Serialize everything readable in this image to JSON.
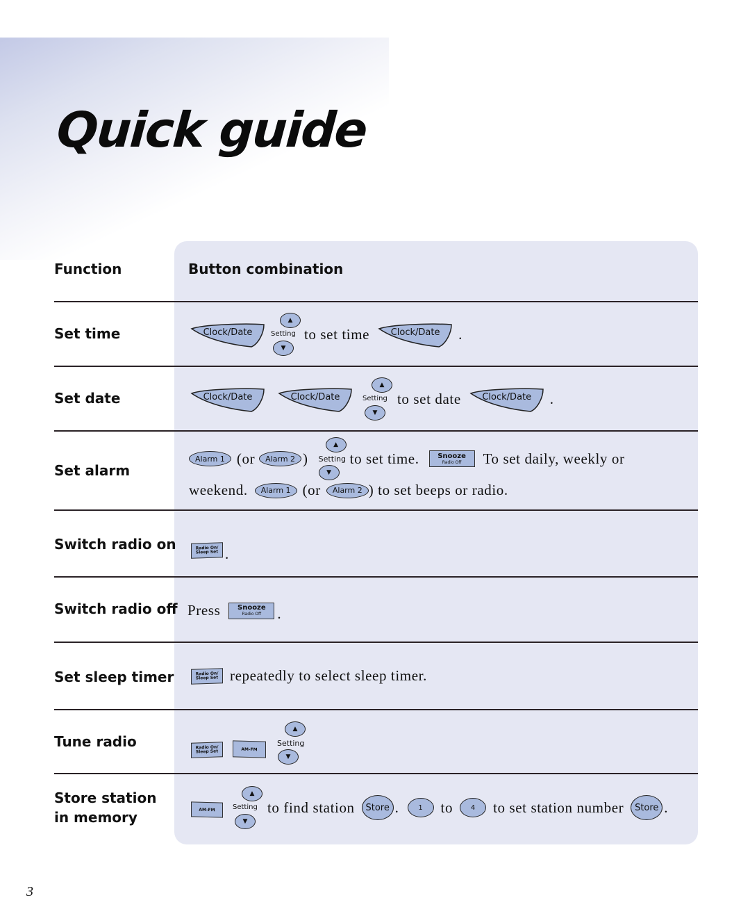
{
  "page": {
    "title": "Quick guide",
    "page_number": "3",
    "colors": {
      "panel": "#e5e7f3",
      "button": "#a9bade",
      "rule": "#2a2226"
    }
  },
  "table": {
    "headers": {
      "function": "Function",
      "combination": "Button combination"
    },
    "rows": [
      {
        "function": "Set time",
        "steps": {
          "b1": "Clock/Date",
          "setting": "Setting",
          "up": "▲",
          "down": "▼",
          "t1": "to set time",
          "b2": "Clock/Date",
          "end": "."
        }
      },
      {
        "function": "Set date",
        "steps": {
          "b1": "Clock/Date",
          "b2": "Clock/Date",
          "setting": "Setting",
          "up": "▲",
          "down": "▼",
          "t1": "to set date",
          "b3": "Clock/Date",
          "end": "."
        }
      },
      {
        "function": "Set alarm",
        "steps": {
          "alarm1": "Alarm 1",
          "or1": "(or",
          "alarm2": "Alarm 2",
          "close1": ")",
          "setting": "Setting",
          "up": "▲",
          "down": "▼",
          "t1": "to set time.",
          "snooze": "Snooze",
          "snooze_sub": "Radio Off",
          "t2": "To set daily, weekly or",
          "t3": "weekend.",
          "alarm1b": "Alarm 1",
          "or2": "(or",
          "alarm2b": "Alarm 2",
          "t4": ") to set beeps or radio."
        }
      },
      {
        "function": "Switch radio on",
        "steps": {
          "radio_on_l1": "Radio On/",
          "radio_on_l2": "Sleep Set",
          "end": "."
        }
      },
      {
        "function": "Switch radio off",
        "steps": {
          "press": "Press",
          "snooze": "Snooze",
          "snooze_sub": "Radio Off",
          "end": "."
        }
      },
      {
        "function": "Set sleep timer",
        "steps": {
          "radio_on_l1": "Radio On/",
          "radio_on_l2": "Sleep Set",
          "t1": "repeatedly to select sleep timer."
        }
      },
      {
        "function": "Tune radio",
        "steps": {
          "radio_on_l1": "Radio On/",
          "radio_on_l2": "Sleep Set",
          "amfm": "AM-FM",
          "setting": "Setting",
          "up": "▲",
          "down": "▼"
        }
      },
      {
        "function_l1": "Store station",
        "function_l2": "in memory",
        "steps": {
          "amfm": "AM-FM",
          "setting": "Setting",
          "up": "▲",
          "down": "▼",
          "t1": "to find station",
          "store1": "Store",
          "dot1": ".",
          "n1": "1",
          "to": "to",
          "n4": "4",
          "t2": "to set station number",
          "store2": "Store",
          "end": "."
        }
      }
    ]
  }
}
